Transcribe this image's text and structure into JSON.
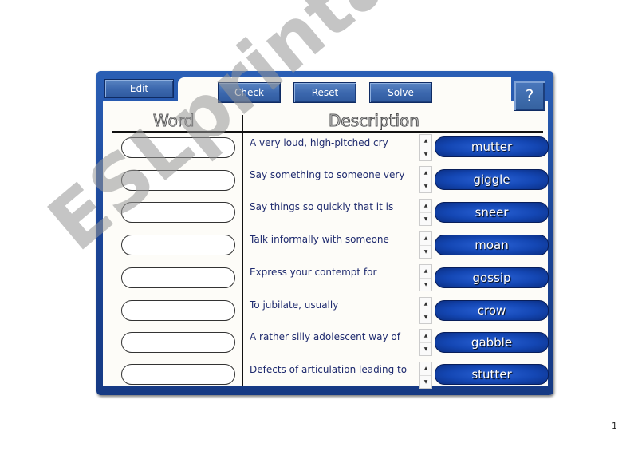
{
  "toolbar": {
    "edit_label": "Edit",
    "check_label": "Check",
    "reset_label": "Reset",
    "solve_label": "Solve",
    "help_label": "?"
  },
  "headers": {
    "word": "Word",
    "description": "Description"
  },
  "rows": [
    {
      "description": "A very loud, high-pitched cry",
      "word_chip": "mutter",
      "answer": ""
    },
    {
      "description": "Say something to someone very",
      "word_chip": "giggle",
      "answer": ""
    },
    {
      "description": "Say things so quickly that it is",
      "word_chip": "sneer",
      "answer": ""
    },
    {
      "description": "Talk informally with someone",
      "word_chip": "moan",
      "answer": ""
    },
    {
      "description": "Express your contempt for",
      "word_chip": "gossip",
      "answer": ""
    },
    {
      "description": "To jubilate, usually",
      "word_chip": "crow",
      "answer": ""
    },
    {
      "description": "A rather silly adolescent way of",
      "word_chip": "gabble",
      "answer": ""
    },
    {
      "description": "Defects of articulation leading to",
      "word_chip": "stutter",
      "answer": ""
    }
  ],
  "spinner": {
    "up": "▲",
    "down": "▼"
  },
  "page_number": "1",
  "watermark": "ESLprintables.com",
  "colors": {
    "frame": "#1b4597",
    "chip": "#1447b4",
    "description_text": "#1e2a6e"
  }
}
